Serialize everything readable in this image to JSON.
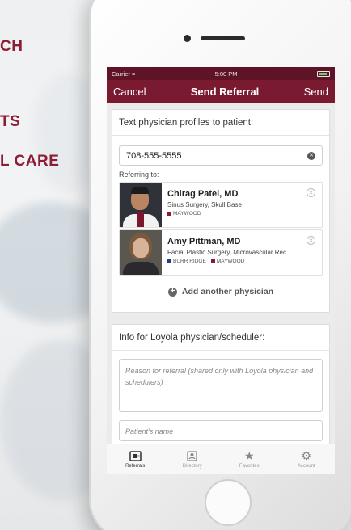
{
  "promo_lines": [
    "CH",
    "TS",
    "L CARE"
  ],
  "status": {
    "carrier": "Carrier",
    "time": "5:00 PM"
  },
  "nav": {
    "cancel": "Cancel",
    "title": "Send Referral",
    "send": "Send"
  },
  "text_card": {
    "title": "Text physician profiles to patient:",
    "phone_value": "708-555-5555",
    "referring_label": "Referring to:",
    "add_label": "Add another physician"
  },
  "physicians": [
    {
      "name": "Chirag Patel, MD",
      "specialty": "Sinus Surgery, Skull Base",
      "locations": [
        {
          "name": "MAYWOOD",
          "color": "#8a1a33"
        }
      ]
    },
    {
      "name": "Amy Pittman, MD",
      "specialty": "Facial Plastic Surgery, Microvascular Rec...",
      "locations": [
        {
          "name": "BURR RIDGE",
          "color": "#1f3f8f"
        },
        {
          "name": "MAYWOOD",
          "color": "#8a1a33"
        }
      ]
    }
  ],
  "info_card": {
    "title": "Info for Loyola physician/scheduler:",
    "reason_placeholder": "Reason for referral (shared only with Loyola physician and schedulers)",
    "patient_placeholder": "Patient's name"
  },
  "tabs": [
    {
      "label": "Referrals",
      "icon": "referrals-icon"
    },
    {
      "label": "Directory",
      "icon": "directory-icon"
    },
    {
      "label": "Favorites",
      "icon": "star-icon"
    },
    {
      "label": "Account",
      "icon": "gear-icon"
    }
  ],
  "colors": {
    "brand": "#7a1a31",
    "statusbar": "#5e1426",
    "promo_text": "#8c1d35"
  }
}
